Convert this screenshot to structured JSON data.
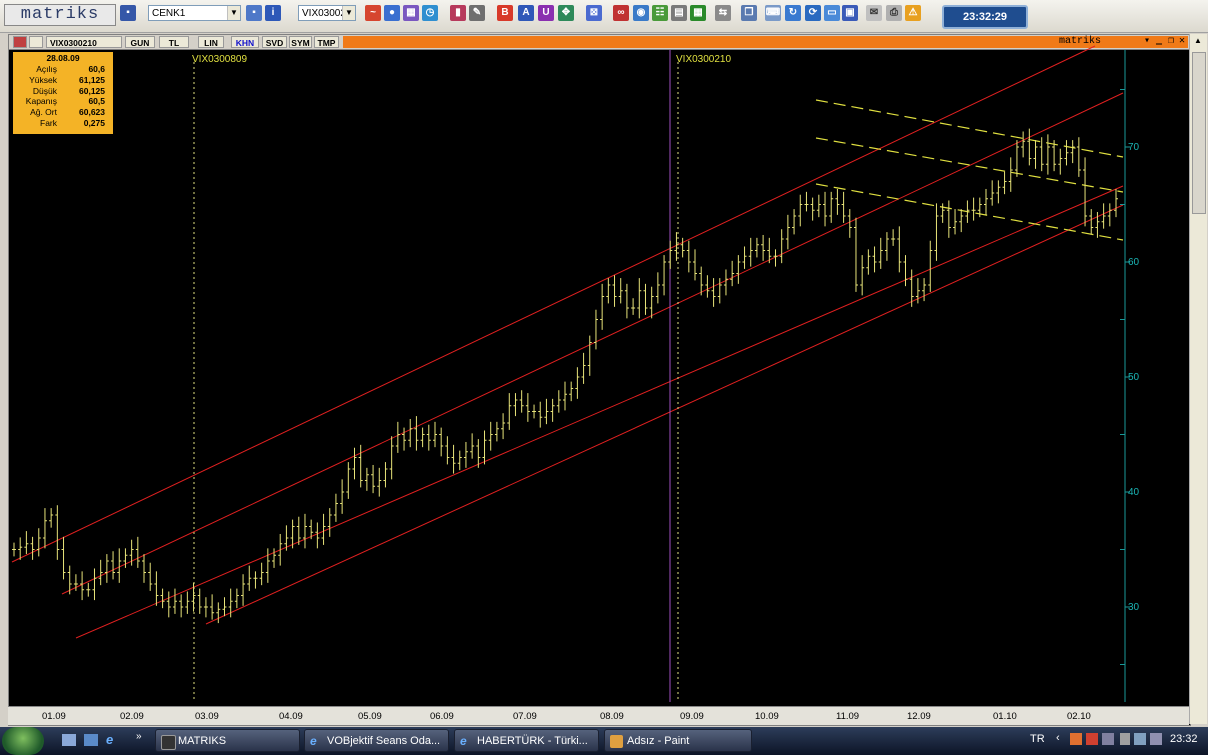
{
  "app": {
    "logo": "matriks"
  },
  "toolbar": {
    "template_value": "CENK1",
    "symbol_value": "VIX03002",
    "clock": "23:32:29"
  },
  "chart_window": {
    "symbol": "VIX0300210",
    "tabs": [
      "GUN",
      "TL",
      "LIN",
      "KHN",
      "SVD",
      "SYM",
      "TMP"
    ],
    "active_tab": "KHN",
    "brand": "matriks",
    "contract_markers": [
      "VIX0300809",
      "VIX0300210"
    ]
  },
  "info": {
    "date": "28.08.09",
    "rows": [
      {
        "label": "Açılış",
        "value": "60,6"
      },
      {
        "label": "Yüksek",
        "value": "61,125"
      },
      {
        "label": "Düşük",
        "value": "60,125"
      },
      {
        "label": "Kapanış",
        "value": "60,5"
      },
      {
        "label": "Ağ. Ort",
        "value": "60,623"
      },
      {
        "label": "Fark",
        "value": "0,275"
      }
    ]
  },
  "chart_data": {
    "type": "ohlc",
    "y_ticks": [
      30,
      40,
      50,
      60,
      70
    ],
    "ylim": [
      25,
      78
    ],
    "x_ticks": [
      "01.09",
      "02.09",
      "03.09",
      "04.09",
      "05.09",
      "06.09",
      "07.09",
      "08.09",
      "09.09",
      "10.09",
      "11.09",
      "12.09",
      "01.10",
      "02.10"
    ],
    "series": [
      {
        "values": [
          35,
          35.2,
          35.5,
          35,
          36,
          37.5,
          38,
          35,
          33,
          32,
          32,
          31.5,
          31.5,
          32.5,
          33,
          34,
          33,
          34,
          34.5,
          35,
          34,
          33,
          32,
          31,
          30.5,
          30,
          30.5,
          30,
          30.5,
          31,
          30,
          30,
          29.5,
          29.8,
          30,
          30.5,
          31,
          32,
          32.5,
          32.5,
          33,
          34,
          34.5,
          35.5,
          36,
          37,
          36,
          37,
          36.5,
          36,
          37,
          38,
          39,
          40,
          42,
          43,
          41,
          41.5,
          40.5,
          41,
          42,
          44,
          45,
          44.5,
          45.5,
          44.5,
          45,
          44.5,
          45,
          44,
          43,
          42.5,
          43,
          43.5,
          44,
          43,
          44.5,
          45,
          45.5,
          46,
          47.5,
          48,
          47.5,
          47,
          47,
          46.5,
          47,
          47.5,
          48,
          48.5,
          49,
          50,
          51,
          53,
          55,
          57,
          58,
          57,
          57.5,
          56,
          56,
          57.5,
          56,
          57,
          58,
          60,
          61,
          61.5,
          61,
          60,
          59,
          58,
          57.5,
          57,
          58,
          58.5,
          59,
          60,
          60.5,
          61,
          61.5,
          61,
          60.5,
          60.5,
          62,
          63,
          64,
          65,
          65,
          64.5,
          65,
          64,
          65.5,
          65,
          64,
          63,
          58,
          59.5,
          60.5,
          60,
          61,
          62,
          62,
          60,
          58.5,
          57,
          57.5,
          58,
          61,
          64,
          64.5,
          63,
          63.5,
          64,
          64.5,
          64.5,
          65,
          65.5,
          66,
          66.5,
          67,
          68,
          70,
          70.5,
          69,
          70,
          68.5,
          70,
          68.5,
          69,
          69.5,
          70,
          68,
          64,
          63,
          63.5,
          64,
          64.5,
          65.5
        ]
      }
    ]
  }
}
